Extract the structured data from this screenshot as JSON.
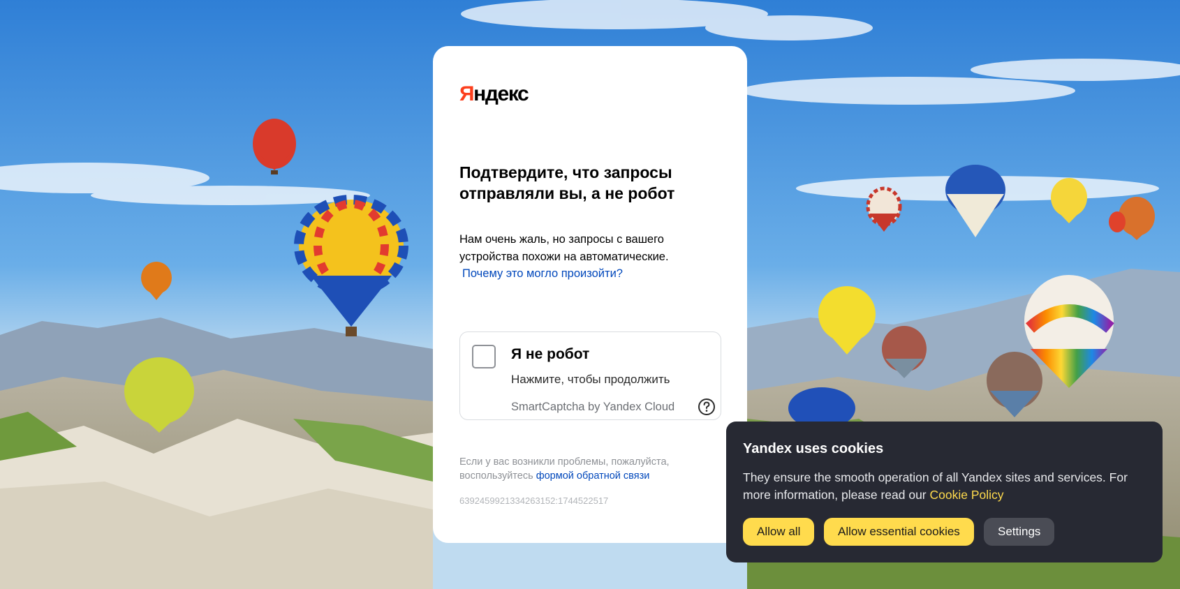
{
  "background": {
    "description_icon": "hot-air-balloons-landscape",
    "sky_color": "#3f8fdd",
    "horizon_color": "#bcd8ec"
  },
  "card": {
    "logo_first": "Я",
    "logo_rest": "ндекс",
    "title": "Подтвердите, что запросы отправляли вы, а не робот",
    "description": "Нам очень жаль, но запросы с вашего устройства похожи на автоматические.",
    "why_link": "Почему это могло произойти?",
    "captcha": {
      "title": "Я не робот",
      "subtitle": "Нажмите, чтобы продолжить",
      "brand": "SmartCaptcha by Yandex Cloud",
      "help_icon": "question-circle-icon"
    },
    "footer_text": "Если у вас возникли проблемы, пожалуйста, воспользуйтесь",
    "footer_link": "формой обратной связи",
    "request_id": "6392459921334263152:1744522517"
  },
  "cookie_banner": {
    "title": "Yandex uses cookies",
    "text": "They ensure the smooth operation of all Yandex sites and services. For more information, please read our",
    "link": "Cookie Policy",
    "buttons": {
      "allow_all": "Allow all",
      "allow_essential": "Allow essential cookies",
      "settings": "Settings"
    }
  },
  "colors": {
    "brand_red": "#fc3f1d",
    "link_blue": "#0047bb",
    "cookie_bg": "#272933",
    "yellow": "#ffdb4d"
  }
}
